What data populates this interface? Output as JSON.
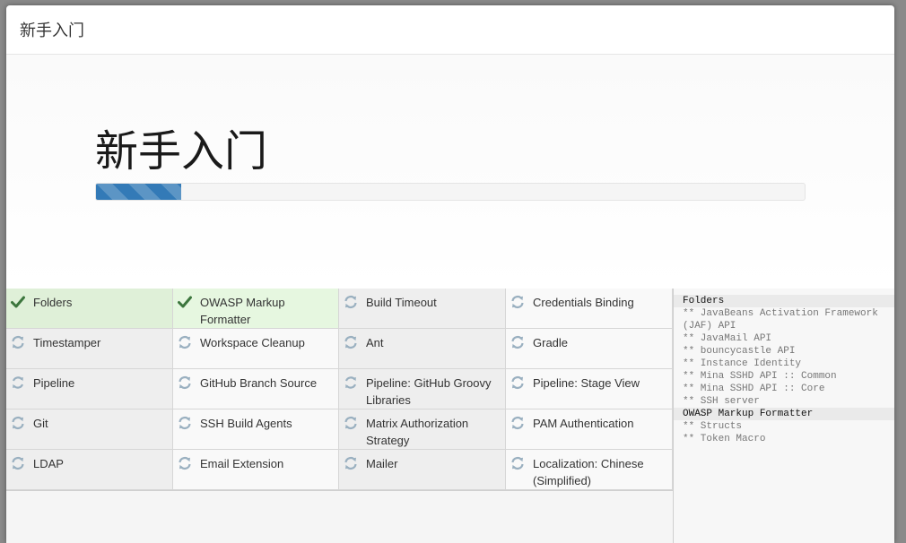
{
  "dialog": {
    "title": "新手入门"
  },
  "hero": {
    "title": "新手入门",
    "progress": 0.12
  },
  "plugins": [
    {
      "name": "Folders",
      "status": "installed"
    },
    {
      "name": "OWASP Markup Formatter",
      "status": "installed"
    },
    {
      "name": "Build Timeout",
      "status": "pending"
    },
    {
      "name": "Credentials Binding",
      "status": "pending"
    },
    {
      "name": "Timestamper",
      "status": "pending"
    },
    {
      "name": "Workspace Cleanup",
      "status": "pending"
    },
    {
      "name": "Ant",
      "status": "pending"
    },
    {
      "name": "Gradle",
      "status": "pending"
    },
    {
      "name": "Pipeline",
      "status": "installing"
    },
    {
      "name": "GitHub Branch Source",
      "status": "pending"
    },
    {
      "name": "Pipeline: GitHub Groovy Libraries",
      "status": "installing"
    },
    {
      "name": "Pipeline: Stage View",
      "status": "pending"
    },
    {
      "name": "Git",
      "status": "pending"
    },
    {
      "name": "SSH Build Agents",
      "status": "pending"
    },
    {
      "name": "Matrix Authorization Strategy",
      "status": "pending"
    },
    {
      "name": "PAM Authentication",
      "status": "pending"
    },
    {
      "name": "LDAP",
      "status": "pending"
    },
    {
      "name": "Email Extension",
      "status": "pending"
    },
    {
      "name": "Mailer",
      "status": "pending"
    },
    {
      "name": "Localization: Chinese (Simplified)",
      "status": "pending"
    }
  ],
  "log": [
    {
      "text": "Folders",
      "kind": "head"
    },
    {
      "text": "** JavaBeans Activation Framework (JAF) API",
      "kind": "dep"
    },
    {
      "text": "** JavaMail API",
      "kind": "dep"
    },
    {
      "text": "** bouncycastle API",
      "kind": "dep"
    },
    {
      "text": "** Instance Identity",
      "kind": "dep"
    },
    {
      "text": "** Mina SSHD API :: Common",
      "kind": "dep"
    },
    {
      "text": "** Mina SSHD API :: Core",
      "kind": "dep"
    },
    {
      "text": "** SSH server",
      "kind": "dep"
    },
    {
      "text": "OWASP Markup Formatter",
      "kind": "head"
    },
    {
      "text": "** Structs",
      "kind": "dep"
    },
    {
      "text": "** Token Macro",
      "kind": "dep"
    }
  ],
  "colors": {
    "progress": "#337ab7",
    "success_icon": "#3c763d",
    "pending_icon": "#9ab0c0"
  },
  "icons": {
    "installed": "check-icon",
    "pending": "refresh-icon",
    "installing": "refresh-icon"
  }
}
